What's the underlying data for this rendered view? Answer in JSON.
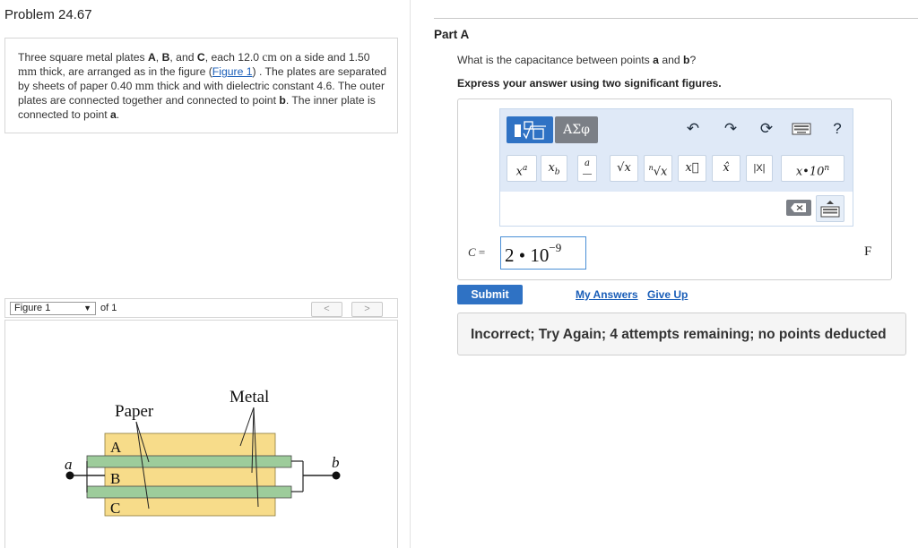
{
  "problem": {
    "title": "Problem 24.67",
    "text_parts": [
      "Three square metal plates ",
      "A",
      ", ",
      "B",
      ", and ",
      "C",
      ", each 12.0 ",
      "cm",
      " on a side and 1.50 ",
      "mm",
      " thick, are arranged as in the figure (",
      "Figure 1",
      ") . The plates are separated by sheets of paper 0.40 ",
      "mm",
      " thick and with dielectric constant 4.6. The outer plates are connected together and connected to point ",
      "b",
      ". The inner plate is connected to point ",
      "a",
      "."
    ]
  },
  "figure": {
    "select_label": "Figure 1",
    "of_label": "of 1",
    "prev_label": "<",
    "next_label": ">",
    "labels": {
      "paper": "Paper",
      "metal": "Metal",
      "a": "a",
      "b": "b",
      "plate_A": "A",
      "plate_B": "B",
      "plate_C": "C"
    },
    "colors": {
      "paper": "#f7dc8a",
      "metal": "#9dcc9b",
      "wire": "#222222"
    }
  },
  "part": {
    "title": "Part A",
    "question_prefix": "What is the capacitance between points ",
    "question_a": "a",
    "question_mid": " and ",
    "question_b": "b",
    "question_suffix": "?",
    "instructions": "Express your answer using two significant figures."
  },
  "editor": {
    "symbols_label": "ΑΣφ",
    "help_label": "?",
    "templates": [
      {
        "name": "superscript",
        "label": "xᵃ"
      },
      {
        "name": "subscript",
        "label": "x_b"
      },
      {
        "name": "fraction",
        "label": "a/b"
      },
      {
        "name": "sqrt",
        "label": "√x"
      },
      {
        "name": "nth-root",
        "label": "ⁿ√x"
      },
      {
        "name": "vector",
        "label": "x⃗"
      },
      {
        "name": "unit-vector",
        "label": "x̂"
      },
      {
        "name": "abs",
        "label": "|X|"
      },
      {
        "name": "sci-notation",
        "label": "x• 10ⁿ"
      }
    ],
    "icons": [
      "templates-icon",
      "greek-symbols-icon",
      "undo-icon",
      "redo-icon",
      "reset-icon",
      "keyboard-icon",
      "help-icon",
      "backspace-icon",
      "keyboard-toggle-icon"
    ]
  },
  "answer": {
    "variable": "C",
    "equals": " =",
    "mantissa": "2",
    "dot": " • ",
    "base": "10",
    "exponent": "−9",
    "unit": "F"
  },
  "actions": {
    "submit_label": "Submit",
    "my_answers_label": "My Answers",
    "give_up_label": "Give Up"
  },
  "feedback": {
    "message": "Incorrect; Try Again; 4 attempts remaining; no points deducted"
  },
  "colors": {
    "primary_blue": "#2f72c4",
    "link_blue": "#1a5eb8",
    "toolbar_bg": "#dfe9f7",
    "feedback_bg": "#f5f5f5"
  }
}
